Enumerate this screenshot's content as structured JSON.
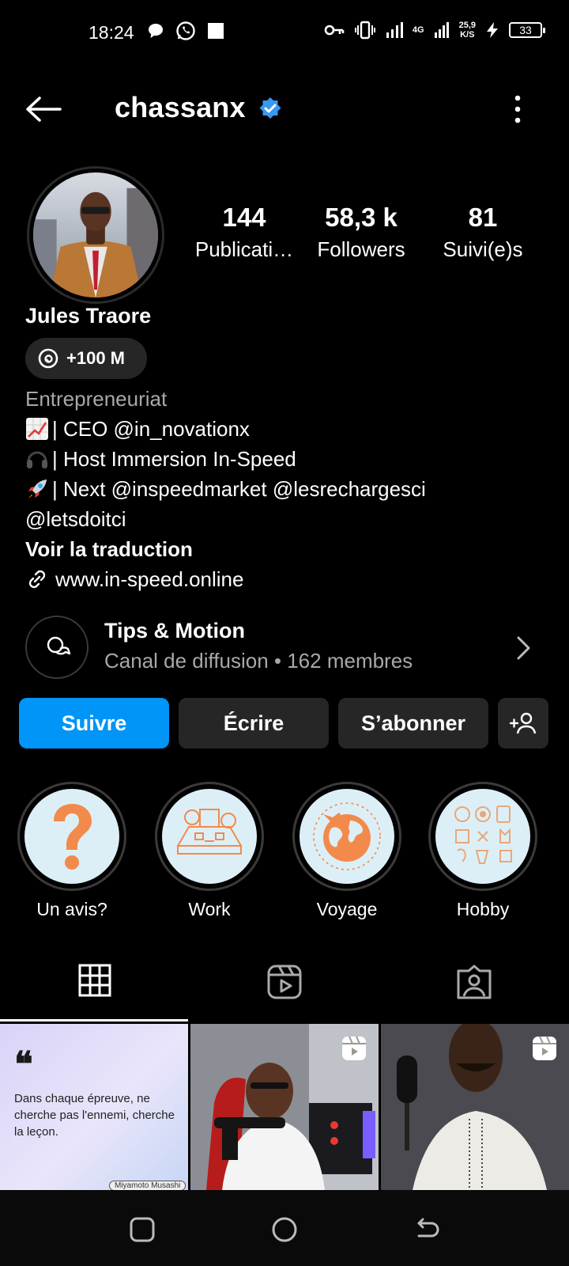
{
  "status_bar": {
    "time": "18:24",
    "network": "4G",
    "speed_value": "25,9",
    "speed_unit": "K/S",
    "battery": "33"
  },
  "header": {
    "username": "chassanx"
  },
  "profile": {
    "stats": [
      {
        "value": "144",
        "label": "Publicati…"
      },
      {
        "value": "58,3 k",
        "label": "Followers"
      },
      {
        "value": "81",
        "label": "Suivi(e)s"
      }
    ],
    "display_name": "Jules Traore",
    "threads_count": "+100 M",
    "bio": {
      "category": "Entrepreneuriat",
      "line1": "| CEO @in_novationx",
      "line2": "| Host Immersion In-Speed",
      "line3": "| Next @inspeedmarket @lesrechargesci",
      "line4": "@letsdoitci",
      "translate": "Voir la traduction",
      "link": "www.in-speed.online"
    }
  },
  "channel": {
    "title": "Tips & Motion",
    "subtitle": "Canal de diffusion • 162 membres"
  },
  "actions": {
    "follow": "Suivre",
    "message": "Écrire",
    "subscribe": "S’abonner"
  },
  "highlights": [
    {
      "label": "Un avis?"
    },
    {
      "label": "Work"
    },
    {
      "label": "Voyage"
    },
    {
      "label": "Hobby"
    }
  ],
  "posts": {
    "quote_mark": "❝",
    "quote_text": "Dans chaque épreuve, ne cherche pas l'ennemi, cherche la leçon.",
    "quote_author": "Miyamoto Musashi"
  },
  "colors": {
    "accent": "#0095f6",
    "verified": "#3897f0",
    "highlight_orange": "#f28a4c"
  }
}
